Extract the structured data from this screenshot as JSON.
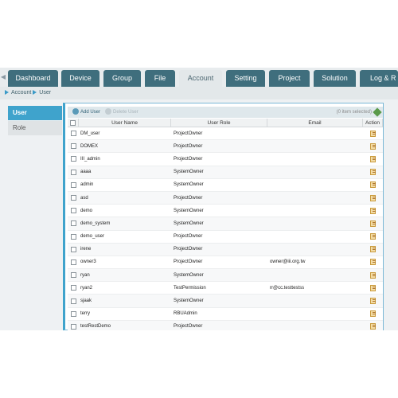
{
  "tabs": [
    "Dashboard",
    "Device",
    "Group",
    "File",
    "Account",
    "Setting",
    "Project",
    "Solution",
    "Log & R"
  ],
  "active_tab": "Account",
  "breadcrumb": [
    "Account",
    "User"
  ],
  "sidebar": {
    "items": [
      "User",
      "Role"
    ]
  },
  "toolbar": {
    "add_label": "Add User",
    "delete_label": "Delete User",
    "selected_text": "(0 item selected)"
  },
  "table": {
    "columns": [
      "User Name",
      "User Role",
      "Email",
      "Action"
    ],
    "rows": [
      {
        "name": "DM_user",
        "role": "ProjectOwner",
        "email": ""
      },
      {
        "name": "DOMEX",
        "role": "ProjectOwner",
        "email": ""
      },
      {
        "name": "III_admin",
        "role": "ProjectOwner",
        "email": ""
      },
      {
        "name": "aaaa",
        "role": "SystemOwner",
        "email": ""
      },
      {
        "name": "admin",
        "role": "SystemOwner",
        "email": ""
      },
      {
        "name": "asd",
        "role": "ProjectOwner",
        "email": ""
      },
      {
        "name": "demo",
        "role": "SystemOwner",
        "email": ""
      },
      {
        "name": "demo_system",
        "role": "SystemOwner",
        "email": ""
      },
      {
        "name": "demo_user",
        "role": "ProjectOwner",
        "email": ""
      },
      {
        "name": "irene",
        "role": "ProjectOwner",
        "email": ""
      },
      {
        "name": "owner3",
        "role": "ProjectOwner",
        "email": "owner@iii.org.tw"
      },
      {
        "name": "ryan",
        "role": "SystemOwner",
        "email": ""
      },
      {
        "name": "ryan2",
        "role": "TestPermission",
        "email": "rr@cc.testtestss"
      },
      {
        "name": "sjaak",
        "role": "SystemOwner",
        "email": ""
      },
      {
        "name": "terry",
        "role": "RBUAdmin",
        "email": ""
      },
      {
        "name": "testRestDemo",
        "role": "ProjectOwner",
        "email": ""
      }
    ]
  },
  "colors": {
    "tab": "#3f6e7d",
    "accent": "#3fa3cc",
    "background": "#e8ecee"
  }
}
